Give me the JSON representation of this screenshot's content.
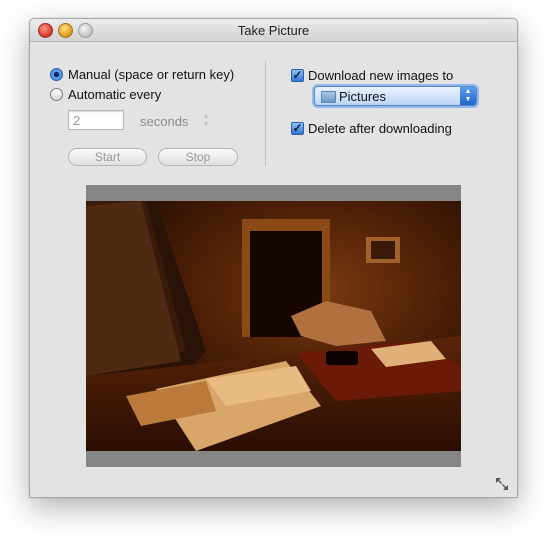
{
  "window": {
    "title": "Take Picture"
  },
  "capture_mode": {
    "manual_label": "Manual (space or return key)",
    "manual_selected": true,
    "automatic_label": "Automatic every",
    "automatic_selected": false,
    "interval_value": "2",
    "interval_unit": "seconds"
  },
  "buttons": {
    "start": "Start",
    "stop": "Stop"
  },
  "download": {
    "checkbox_label": "Download new images to",
    "checked": true,
    "destination": "Pictures",
    "destination_icon": "folder-icon"
  },
  "delete": {
    "checkbox_label": "Delete after downloading",
    "checked": true
  },
  "icons": {
    "resize": "resize-arrows-icon"
  }
}
